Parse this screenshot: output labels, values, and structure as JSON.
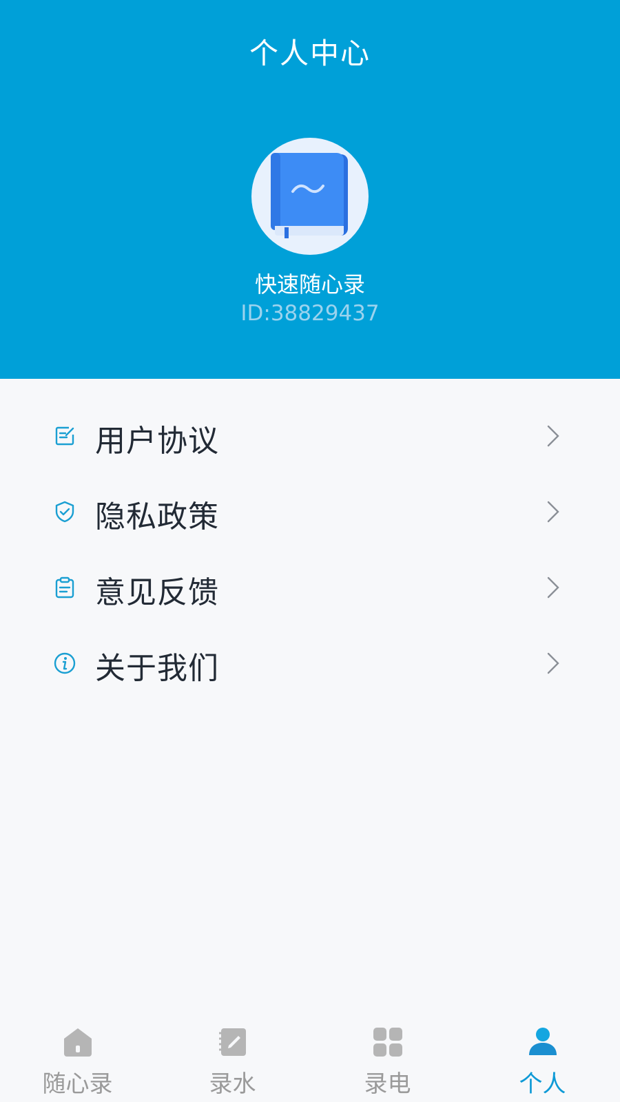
{
  "header": {
    "title": "个人中心",
    "app_name": "快速随心录",
    "user_id": "ID:38829437",
    "avatar_icon": "book-icon"
  },
  "menu": {
    "items": [
      {
        "label": "用户协议",
        "icon": "document-edit-icon"
      },
      {
        "label": "隐私政策",
        "icon": "shield-check-icon"
      },
      {
        "label": "意见反馈",
        "icon": "clipboard-icon"
      },
      {
        "label": "关于我们",
        "icon": "info-icon"
      }
    ]
  },
  "tabbar": {
    "tabs": [
      {
        "label": "随心录",
        "icon": "home-icon",
        "active": false
      },
      {
        "label": "录水",
        "icon": "notebook-pen-icon",
        "active": false
      },
      {
        "label": "录电",
        "icon": "grid-icon",
        "active": false
      },
      {
        "label": "个人",
        "icon": "person-icon",
        "active": true
      }
    ]
  },
  "colors": {
    "header_bg": "#00a0d8",
    "accent": "#0e9ad6",
    "icon_inactive": "#b5b5b5",
    "page_bg": "#f7f8fa"
  }
}
